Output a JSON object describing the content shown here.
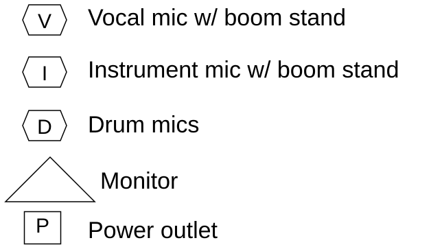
{
  "legend": {
    "items": [
      {
        "symbol": "hexagon",
        "letter": "V",
        "label": "Vocal mic w/ boom stand"
      },
      {
        "symbol": "hexagon",
        "letter": "I",
        "label": "Instrument mic w/ boom stand"
      },
      {
        "symbol": "hexagon",
        "letter": "D",
        "label": "Drum mics"
      },
      {
        "symbol": "triangle",
        "letter": "",
        "label": "Monitor"
      },
      {
        "symbol": "square",
        "letter": "P",
        "label": "Power outlet"
      }
    ]
  }
}
